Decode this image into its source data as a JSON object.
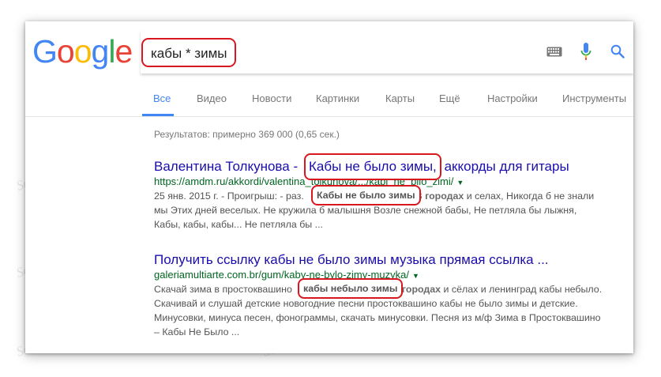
{
  "logo": {
    "letters": [
      "G",
      "o",
      "o",
      "g",
      "l",
      "e"
    ],
    "colors": [
      "#4285f4",
      "#ea4335",
      "#fbbc05",
      "#4285f4",
      "#34a853",
      "#ea4335"
    ]
  },
  "search": {
    "query": "кабы * зимы"
  },
  "icons": {
    "keyboard": "keyboard-icon",
    "mic": "microphone-icon",
    "search": "search-icon"
  },
  "tabs": [
    {
      "label": "Все",
      "active": true
    },
    {
      "label": "Видео"
    },
    {
      "label": "Новости"
    },
    {
      "label": "Картинки"
    },
    {
      "label": "Карты"
    },
    {
      "label": "Ещё"
    },
    {
      "label": "Настройки"
    },
    {
      "label": "Инструменты"
    }
  ],
  "stats": "Результатов: примерно 369 000 (0,65 сек.)",
  "results": [
    {
      "title_pre": "Валентина Толкунова -",
      "title_hl": "Кабы не было зимы,",
      "title_post": "аккорды для гитары",
      "url": "https://amdm.ru/akkordi/valentina_tolkunova/.../kabi_ne_bilo_zimi/",
      "snippet1_pre": "25 янв. 2015 г. - Проигрыш: - раз.",
      "snippet1_hl": "Кабы не было зимы",
      "snippet1_bold": "В городах",
      "snippet1_post": "и селах, Никогда б не знали",
      "snippet2": "мы Этих дней веселых. Не кружила б малышня Возле снежной бабы, Не петляла бы лыжня,",
      "snippet3": "Кабы, кабы, кабы... Не петляла бы ..."
    },
    {
      "title": "Получить ссылку кабы не было зимы музыка прямая ссылка ...",
      "url": "galeriamultiarte.com.br/gum/kaby-ne-bylo-zimy-muzyka/",
      "snippet1_pre": "Скачай зима в простоквашино",
      "snippet1_hl": "кабы небыло зимы",
      "snippet1_bold": "в городах",
      "snippet1_post": "и сёлах и ленинград кабы небыло.",
      "snippet2": "Скачивай и слушай детские новогодние песни простоквашино кабы не было зимы и детские.",
      "snippet3": "Минусовки, минуса песен, фонограммы, скачать минусовки. Песня из м/ф Зима в Простоквашино",
      "snippet4": "– Кабы Не Было ..."
    }
  ]
}
